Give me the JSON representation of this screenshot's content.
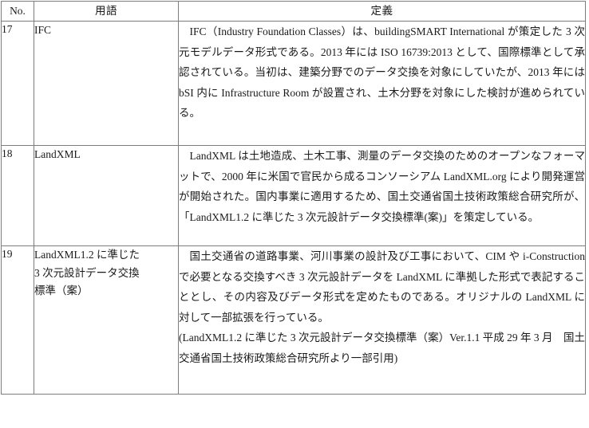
{
  "document": {
    "type": "glossary-table",
    "language": "ja"
  },
  "table": {
    "columns": [
      {
        "key": "no",
        "header": "No."
      },
      {
        "key": "term",
        "header": "用語"
      },
      {
        "key": "def",
        "header": "定義"
      }
    ],
    "rows": [
      {
        "no": "17",
        "term_lines": [
          "IFC"
        ],
        "definition_paragraphs": [
          "IFC（Industry Foundation Classes）は、buildingSMART International が策定した 3 次元モデルデータ形式である。2013 年には ISO 16739:2013 として、国際標準として承認されている。当初は、建築分野でのデータ交換を対象にしていたが、2013 年には bSI 内に Infrastructure Room が設置され、土木分野を対象にした検討が進められている。"
        ]
      },
      {
        "no": "18",
        "term_lines": [
          "LandXML"
        ],
        "definition_paragraphs": [
          "LandXML は土地造成、土木工事、測量のデータ交換のためのオープンなフォーマットで、2000 年に米国で官民から成るコンソーシアム LandXML.org により開発運営が開始された。国内事業に適用するため、国土交通省国土技術政策総合研究所が、「LandXML1.2 に準じた 3 次元設計データ交換標準(案)」を策定している。"
        ]
      },
      {
        "no": "19",
        "term_lines": [
          "LandXML1.2 に準じた",
          "3 次元設計データ交換",
          "標準（案）"
        ],
        "definition_paragraphs": [
          "国土交通省の道路事業、河川事業の設計及び工事において、CIM や i-Construction で必要となる交換すべき 3 次元設計データを LandXML に準拠した形式で表記することとし、その内容及びデータ形式を定めたものである。オリジナルの LandXML に対して一部拡張を行っている。",
          "(LandXML1.2 に準じた 3 次元設計データ交換標準（案）Ver.1.1 平成 29 年 3 月　国土交通省国土技術政策総合研究所より一部引用)"
        ]
      }
    ]
  },
  "colors": {
    "border": "#7d7d7d",
    "text": "#1a1a1a",
    "background": "#ffffff"
  }
}
